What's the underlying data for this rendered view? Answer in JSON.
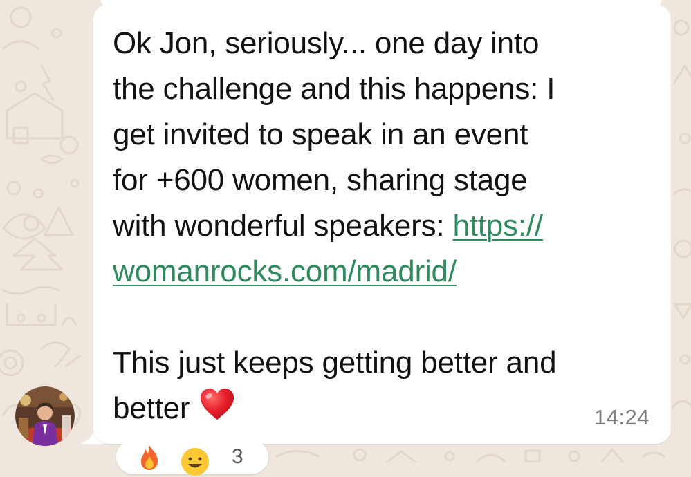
{
  "message": {
    "lines": [
      "Ok Jon, seriously... one day into",
      "the challenge and this happens: I",
      "get invited to speak in an event",
      "for +600 women, sharing stage",
      "with wonderful speakers: "
    ],
    "link_part1": "https://",
    "link_part2": "womanrocks.com/madrid/",
    "line_after": "This just keeps getting better and",
    "last_line": "better",
    "emoji": "red-heart",
    "timestamp": "14:24"
  },
  "reactions": {
    "emojis": [
      "fire",
      "grinning-face"
    ],
    "count": "3"
  },
  "colors": {
    "wallpaper": "#efe7dd",
    "bubble": "#ffffff",
    "link": "#2f8a5d",
    "timestamp": "#7d7d7d",
    "heart": "#e8202b"
  }
}
